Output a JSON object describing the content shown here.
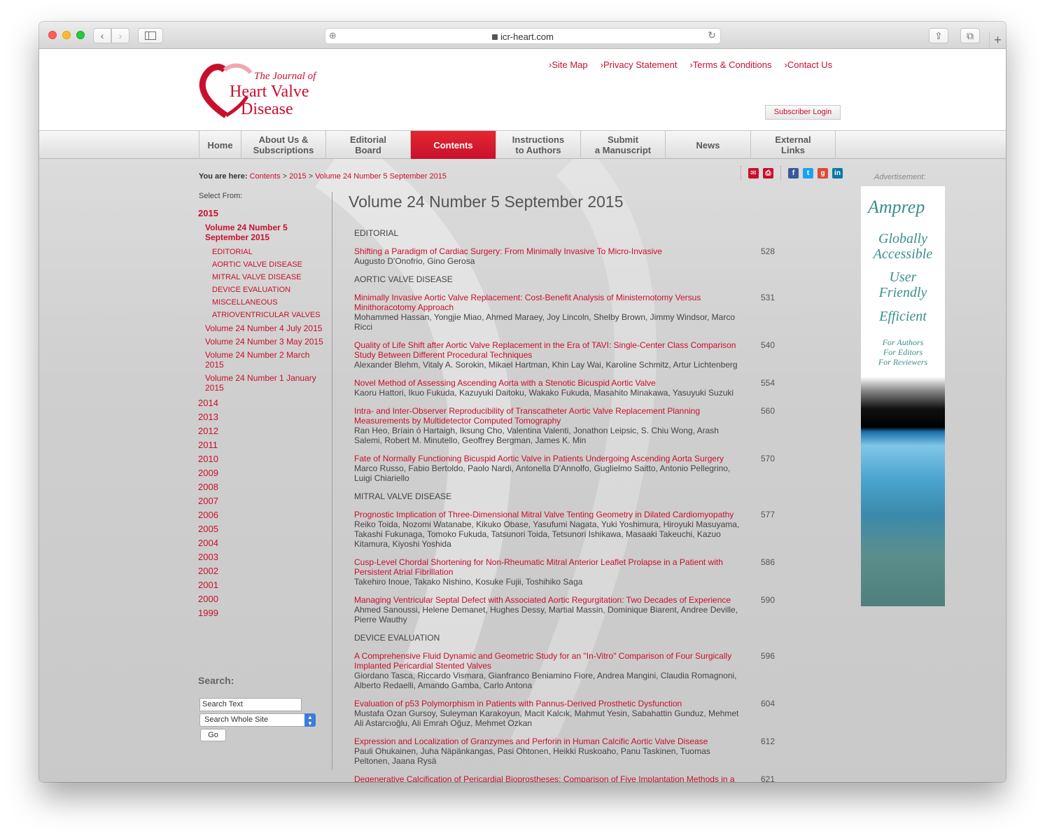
{
  "browser": {
    "url": "icr-heart.com"
  },
  "header": {
    "logo_line1": "The Journal of",
    "logo_line2": "Heart Valve",
    "logo_line3": "Disease",
    "top_links": [
      "›Site Map",
      "›Privacy Statement",
      "›Terms & Conditions",
      "›Contact Us"
    ],
    "subscriber_login": "Subscriber Login"
  },
  "nav": {
    "items": [
      {
        "l1": "Home",
        "l2": ""
      },
      {
        "l1": "About Us &",
        "l2": "Subscriptions"
      },
      {
        "l1": "Editorial",
        "l2": "Board"
      },
      {
        "l1": "Contents",
        "l2": ""
      },
      {
        "l1": "Instructions",
        "l2": "to Authors"
      },
      {
        "l1": "Submit",
        "l2": "a Manuscript"
      },
      {
        "l1": "News",
        "l2": ""
      },
      {
        "l1": "External",
        "l2": "Links"
      }
    ],
    "active": "Contents"
  },
  "breadcrumb": {
    "prefix": "You are here:",
    "c1": "Contents",
    "sep": ">",
    "c2": "2015",
    "c3": "Volume 24 Number 5 September 2015"
  },
  "share_icons": [
    "email-icon",
    "print-icon",
    "facebook-icon",
    "twitter-icon",
    "google-plus-icon",
    "linkedin-icon"
  ],
  "sidebar": {
    "select_from": "Select From:",
    "current_year": "2015",
    "current_volume": "Volume 24 Number 5 September 2015",
    "sections": [
      "EDITORIAL",
      "AORTIC VALVE DISEASE",
      "MITRAL VALVE DISEASE",
      "DEVICE EVALUATION",
      "MISCELLANEOUS",
      "ATRIOVENTRICULAR VALVES"
    ],
    "other_volumes": [
      "Volume 24 Number 4 July 2015",
      "Volume 24 Number 3 May 2015",
      "Volume 24 Number 2 March 2015",
      "Volume 24 Number 1 January 2015"
    ],
    "years": [
      "2014",
      "2013",
      "2012",
      "2011",
      "2010",
      "2009",
      "2008",
      "2007",
      "2006",
      "2005",
      "2004",
      "2003",
      "2002",
      "2001",
      "2000",
      "1999"
    ]
  },
  "search": {
    "title": "Search:",
    "input_value": "Search Text",
    "scope": "Search Whole Site",
    "go": "Go"
  },
  "main": {
    "title": "Volume 24 Number 5 September 2015",
    "sections": [
      {
        "name": "EDITORIAL",
        "articles": [
          {
            "title": "Shifting a Paradigm of Cardiac Surgery: From Minimally Invasive To Micro-Invasive",
            "authors": "Augusto D'Onofrio, Gino Gerosa",
            "page": "528"
          }
        ]
      },
      {
        "name": "AORTIC VALVE DISEASE",
        "articles": [
          {
            "title": "Minimally Invasive Aortic Valve Replacement: Cost-Benefit Analysis of Ministernotomy Versus Minithoracotomy Approach",
            "authors": "Mohammed Hassan, Yongjie Miao, Ahmed Maraey, Joy Lincoln, Shelby Brown, Jimmy Windsor, Marco Ricci",
            "page": "531"
          },
          {
            "title": "Quality of Life Shift after Aortic Valve Replacement in the Era of TAVI: Single-Center Class Comparison Study Between Different Procedural Techniques",
            "authors": "Alexander Blehm, Vitaly A. Sorokin, Mikael Hartman, Khin Lay Wai, Karoline Schmitz, Artur Lichtenberg",
            "page": "540"
          },
          {
            "title": "Novel Method of Assessing Ascending Aorta with a Stenotic Bicuspid Aortic Valve",
            "authors": "Kaoru Hattori, Ikuo Fukuda, Kazuyuki Daitoku, Wakako Fukuda, Masahito Minakawa, Yasuyuki Suzuki",
            "page": "554"
          },
          {
            "title": "Intra- and Inter-Observer Reproducibility of Transcatheter Aortic Valve Replacement Planning Measurements by Multidetector Computed Tomography",
            "authors": "Ran Heo, Bríain ó Hartaigh, Iksung Cho, Valentina Valenti, Jonathon Leipsic, S. Chiu Wong, Arash Salemi, Robert M. Minutello, Geoffrey Bergman, James K. Min",
            "page": "560"
          },
          {
            "title": "Fate of Normally Functioning Bicuspid Aortic Valve in Patients Undergoing Ascending Aorta Surgery",
            "authors": "Marco Russo, Fabio Bertoldo, Paolo Nardi, Antonella D'Annolfo, Guglielmo Saitto, Antonio Pellegrino, Luigi Chiariello",
            "page": "570"
          }
        ]
      },
      {
        "name": "MITRAL VALVE DISEASE",
        "articles": [
          {
            "title": "Prognostic Implication of Three-Dimensional Mitral Valve Tenting Geometry in Dilated Cardiomyopathy",
            "authors": "Reiko Toida, Nozomi Watanabe, Kikuko Obase, Yasufumi Nagata, Yuki Yoshimura, Hiroyuki Masuyama, Takashi Fukunaga, Tomoko Fukuda, Tatsunori Toida, Tetsunori Ishikawa, Masaaki Takeuchi, Kazuo Kitamura, Kiyoshi Yoshida",
            "page": "577"
          },
          {
            "title": "Cusp-Level Chordal Shortening for Non-Rheumatic Mitral Anterior Leaflet Prolapse in a Patient with Persistent Atrial Fibrillation",
            "authors": "Takehiro Inoue, Takako Nishino, Kosuke Fujii, Toshihiko Saga",
            "page": "586"
          },
          {
            "title": "Managing Ventricular Septal Defect with Associated Aortic Regurgitation: Two Decades of Experience",
            "authors": "Ahmed Sanoussi, Helene Demanet, Hughes Dessy, Martial Massin, Dominique Biarent, Andree Deville, Pierre Wauthy",
            "page": "590"
          }
        ]
      },
      {
        "name": "DEVICE EVALUATION",
        "articles": [
          {
            "title": "A Comprehensive Fluid Dynamic and Geometric Study for an \"In-Vitro\" Comparison of Four Surgically Implanted Pericardial Stented Valves",
            "authors": "Giordano Tasca, Riccardo Vismara, Gianfranco Beniamino Fiore, Andrea Mangini, Claudia Romagnoni, Alberto Redaelli, Amando Gamba, Carlo Antona",
            "page": "596"
          },
          {
            "title": "Evaluation of p53 Polymorphism in Patients with Pannus-Derived Prosthetic Dysfunction",
            "authors": "Mustafa Ozan Gursoy, Suleyman Karakoyun, Macit Kalcık, Mahmut Yesin, Sabahattin Gunduz, Mehmet Ali Astarcıoğlu, Ali Emrah Oğuz, Mehmet Ozkan",
            "page": "604"
          },
          {
            "title": "Expression and Localization of Granzymes and Perforin in Human Calcific Aortic Valve Disease",
            "authors": "Pauli Ohukainen, Juha Näpänkangas, Pasi Ohtonen, Heikki Ruskoaho, Panu Taskinen, Tuomas Peltonen, Jaana Rysä",
            "page": "612"
          },
          {
            "title": "Degenerative Calcification of Pericardial Bioprostheses: Comparison of Five Implantation Methods in a",
            "authors": "",
            "page": "621"
          }
        ]
      }
    ]
  },
  "advertisement": {
    "label": "Advertisement:",
    "brand": "Amprep",
    "lines": [
      "Globally",
      "Accessible",
      "User",
      "Friendly",
      "Efficient"
    ],
    "small_lines": [
      "For Authors",
      "For Editors",
      "For Reviewers"
    ]
  }
}
